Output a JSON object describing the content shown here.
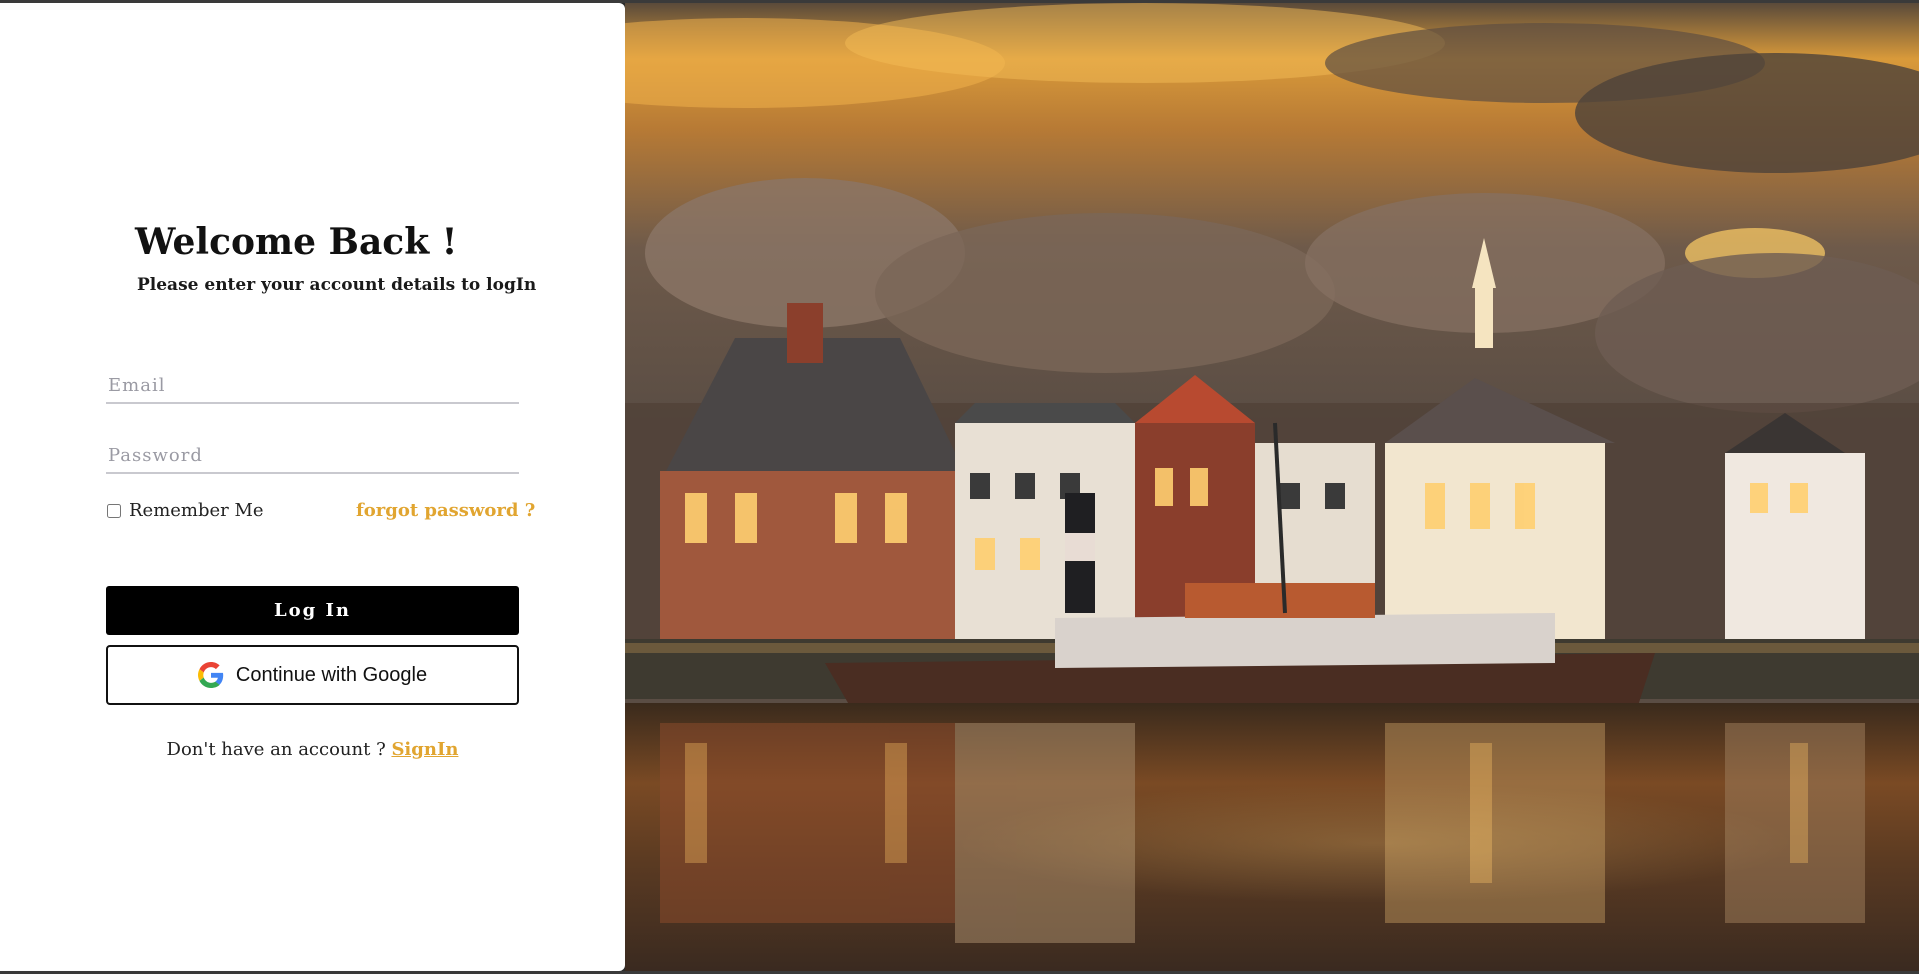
{
  "login": {
    "title": "Welcome Back !",
    "subtitle": "Please enter your account details to logIn",
    "email_placeholder": "Email",
    "password_placeholder": "Password",
    "remember_label": "Remember Me",
    "remember_checked": false,
    "forgot_label": "forgot password ?",
    "login_button": "Log In",
    "google_button": "Continue with Google",
    "signup_prompt": "Don't have an account ? ",
    "signup_link": "SignIn"
  },
  "hero_image": {
    "icon": "harbor-sunset-photo"
  },
  "colors": {
    "accent": "#e1a530",
    "button_bg": "#000000",
    "panel_bg": "#ffffff",
    "input_underline": "#c9c9cf"
  }
}
